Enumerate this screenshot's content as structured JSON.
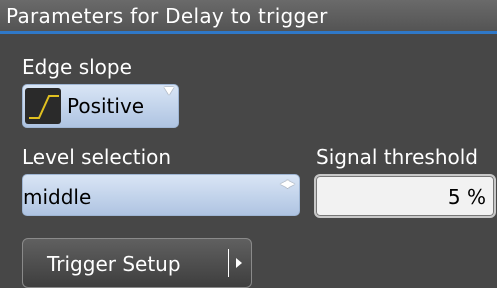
{
  "header": {
    "title": "Parameters for Delay to trigger"
  },
  "edge_slope": {
    "label": "Edge slope",
    "value": "Positive",
    "icon": "rising-edge-icon"
  },
  "level_selection": {
    "label": "Level selection",
    "value": "middle"
  },
  "signal_threshold": {
    "label": "Signal threshold",
    "value": "5 %"
  },
  "trigger_setup": {
    "label": "Trigger Setup"
  },
  "colors": {
    "accent": "#2f78c8",
    "background": "#474747",
    "button_light": "#c6d7ee",
    "edge_icon": "#e0c020"
  }
}
